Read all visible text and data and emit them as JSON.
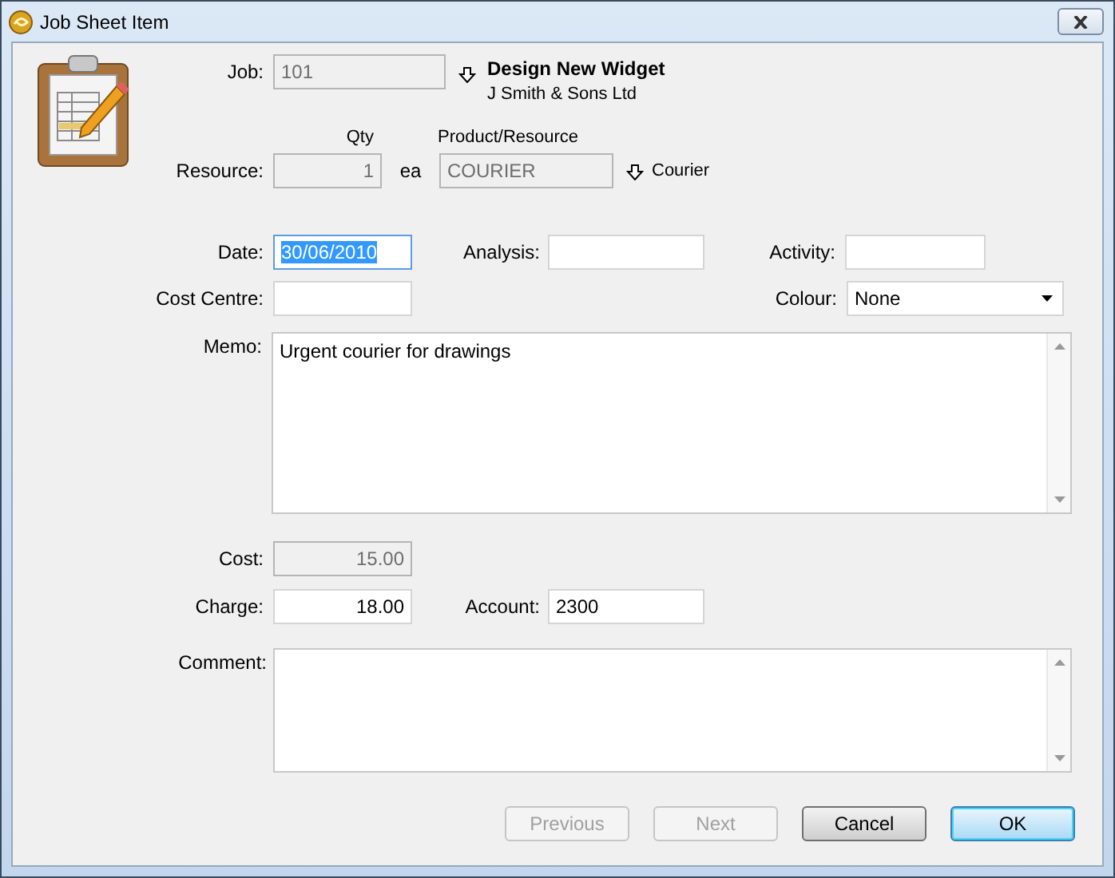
{
  "window": {
    "title": "Job Sheet Item"
  },
  "job": {
    "label": "Job:",
    "field": {
      "value": "101",
      "disabled": true
    },
    "title": "Design New Widget",
    "subtitle": "J Smith & Sons Ltd"
  },
  "resource": {
    "label": "Resource:",
    "qty_header": "Qty",
    "qty": {
      "value": "1",
      "disabled": true
    },
    "unit": "ea",
    "product_header": "Product/Resource",
    "product": {
      "value": "COURIER",
      "disabled": true
    },
    "description": "Courier"
  },
  "date": {
    "label": "Date:",
    "value": "30/06/2010",
    "disabled": false,
    "focused": true
  },
  "analysis": {
    "label": "Analysis:",
    "disabled": false,
    "focused": false
  },
  "activity": {
    "label": "Activity:",
    "disabled": false,
    "focused": false
  },
  "cost_centre": {
    "label": "Cost Centre:",
    "disabled": false,
    "focused": false
  },
  "colour": {
    "label": "Colour:",
    "value": "None"
  },
  "memo": {
    "label": "Memo:",
    "value": "Urgent courier for drawings"
  },
  "cost": {
    "label": "Cost:",
    "value": "15.00",
    "disabled": true,
    "focused": false
  },
  "charge": {
    "label": "Charge:",
    "value": "18.00",
    "disabled": false,
    "focused": false
  },
  "account": {
    "label": "Account:",
    "value": "2300",
    "disabled": false,
    "focused": false
  },
  "comment": {
    "label": "Comment:"
  },
  "buttons": [
    {
      "label": "Previous",
      "disabled": true,
      "default": false
    },
    {
      "label": "Next",
      "disabled": true,
      "default": false
    },
    {
      "label": "Cancel",
      "disabled": false,
      "default": false
    },
    {
      "label": "OK",
      "disabled": false,
      "default": true
    }
  ]
}
